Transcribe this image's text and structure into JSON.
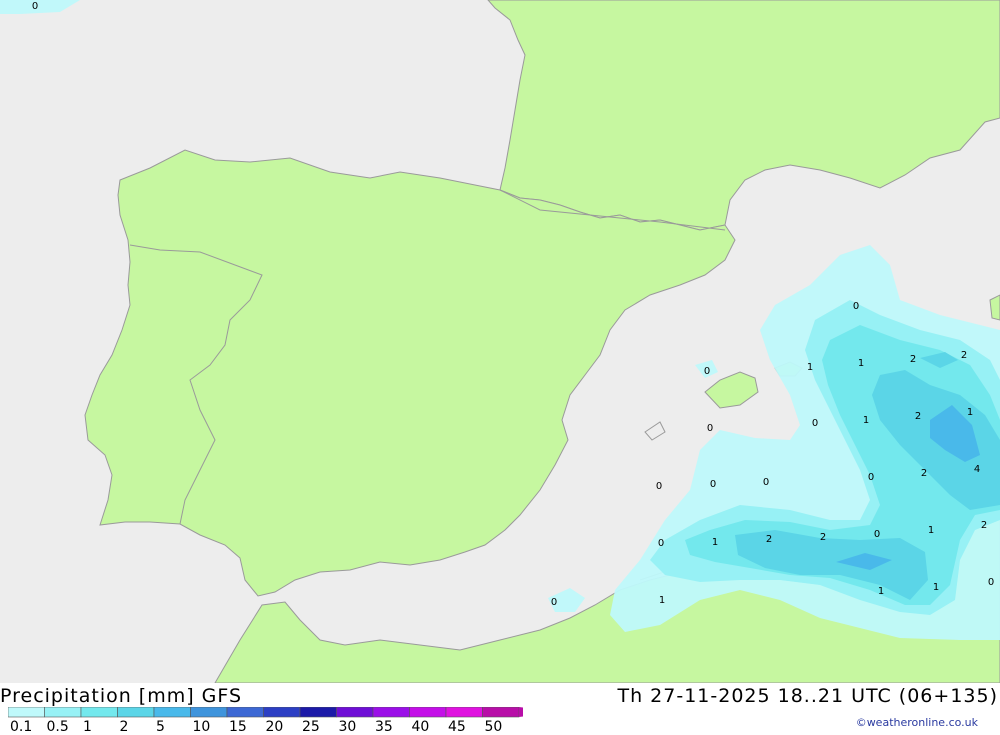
{
  "map": {
    "contour_labels": [
      "0",
      "0",
      "1",
      "1",
      "2",
      "2",
      "0",
      "1",
      "2",
      "1",
      "0",
      "0",
      "0",
      "0",
      "2",
      "4",
      "0",
      "0",
      "0",
      "0",
      "1",
      "2",
      "2",
      "0",
      "1",
      "2",
      "1",
      "1",
      "1",
      "0",
      "0"
    ]
  },
  "footer": {
    "title": "Precipitation [mm] GFS",
    "valid_time": "Th 27-11-2025 18..21 UTC (06+135)",
    "credit": "©weatheronline.co.uk"
  },
  "legend": {
    "ticks": [
      "0.1",
      "0.5",
      "1",
      "2",
      "5",
      "10",
      "15",
      "20",
      "25",
      "30",
      "35",
      "40",
      "45",
      "50"
    ],
    "colors": [
      "#bff9fb",
      "#97f1f5",
      "#73e8ed",
      "#5bd5e7",
      "#49b9ea",
      "#3f94dc",
      "#3d68d4",
      "#2c3fc4",
      "#1c1aa8",
      "#6f0fd6",
      "#9b0fe8",
      "#c40fe8",
      "#e012e0",
      "#b80ea8"
    ]
  },
  "colors": {
    "land": "#c6f7a0",
    "sea": "#ededed",
    "border": "#9a9a9a"
  }
}
